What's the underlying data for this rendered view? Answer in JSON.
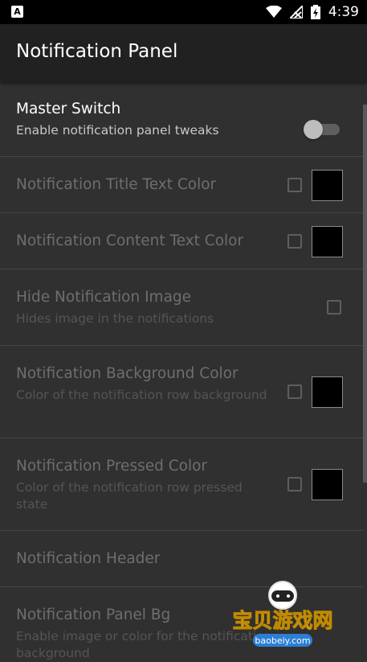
{
  "status_bar": {
    "time": "4:39",
    "left_icon": "A"
  },
  "app_bar": {
    "title": "Notification Panel"
  },
  "rows": [
    {
      "title": "Master Switch",
      "summary": "Enable notification panel tweaks",
      "control": "switch",
      "switch_on": false,
      "enabled": true
    },
    {
      "title": "Notification Title Text Color",
      "summary": "",
      "control": "checkbox+color",
      "checked": false,
      "color": "#000000",
      "enabled": false
    },
    {
      "title": "Notification Content Text Color",
      "summary": "",
      "control": "checkbox+color",
      "checked": false,
      "color": "#000000",
      "enabled": false
    },
    {
      "title": "Hide Notification Image",
      "summary": "Hides image in the notifications",
      "control": "checkbox",
      "checked": false,
      "enabled": false
    },
    {
      "title": "Notification Background Color",
      "summary": "Color of the notification row background",
      "control": "checkbox+color",
      "checked": false,
      "color": "#000000",
      "enabled": false
    },
    {
      "title": "Notification Pressed Color",
      "summary": "Color of the notification row pressed state",
      "control": "checkbox+color",
      "checked": false,
      "color": "#000000",
      "enabled": false
    },
    {
      "title": "Notification Header",
      "summary": "",
      "control": "none",
      "enabled": false
    },
    {
      "title": "Notification Panel Bg",
      "summary": "Enable image or color for the notification background",
      "control": "none",
      "enabled": false
    }
  ],
  "watermark": {
    "text": "宝贝游戏网",
    "url": "baobeiy.com"
  },
  "colors": {
    "background": "#303030",
    "app_bar": "#212121",
    "status_bar": "#000000"
  }
}
